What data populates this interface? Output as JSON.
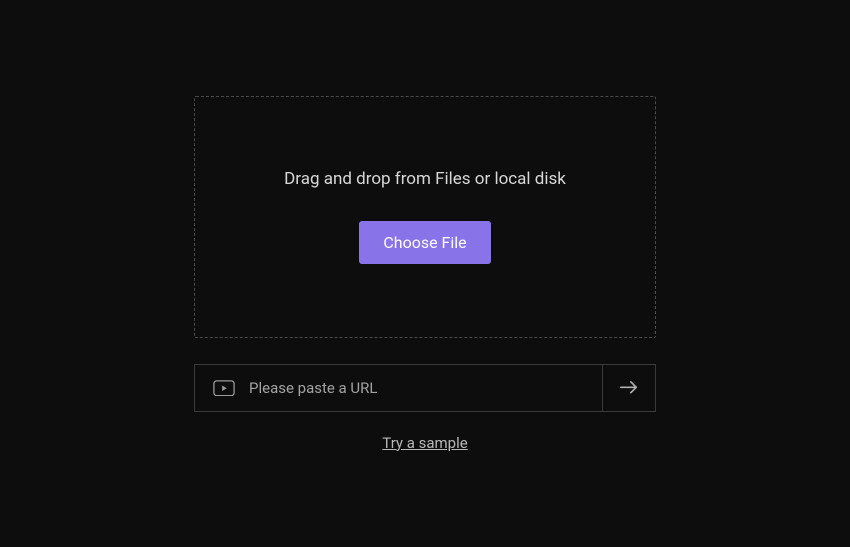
{
  "dropzone": {
    "instruction": "Drag and drop from Files or local disk",
    "button_label": "Choose File"
  },
  "url_input": {
    "placeholder": "Please paste a URL",
    "value": ""
  },
  "sample_link": {
    "label": "Try a sample"
  },
  "colors": {
    "background": "#0d0d0d",
    "accent": "#8873e8",
    "border": "#3a3a3a",
    "text": "#d8d8d8"
  }
}
